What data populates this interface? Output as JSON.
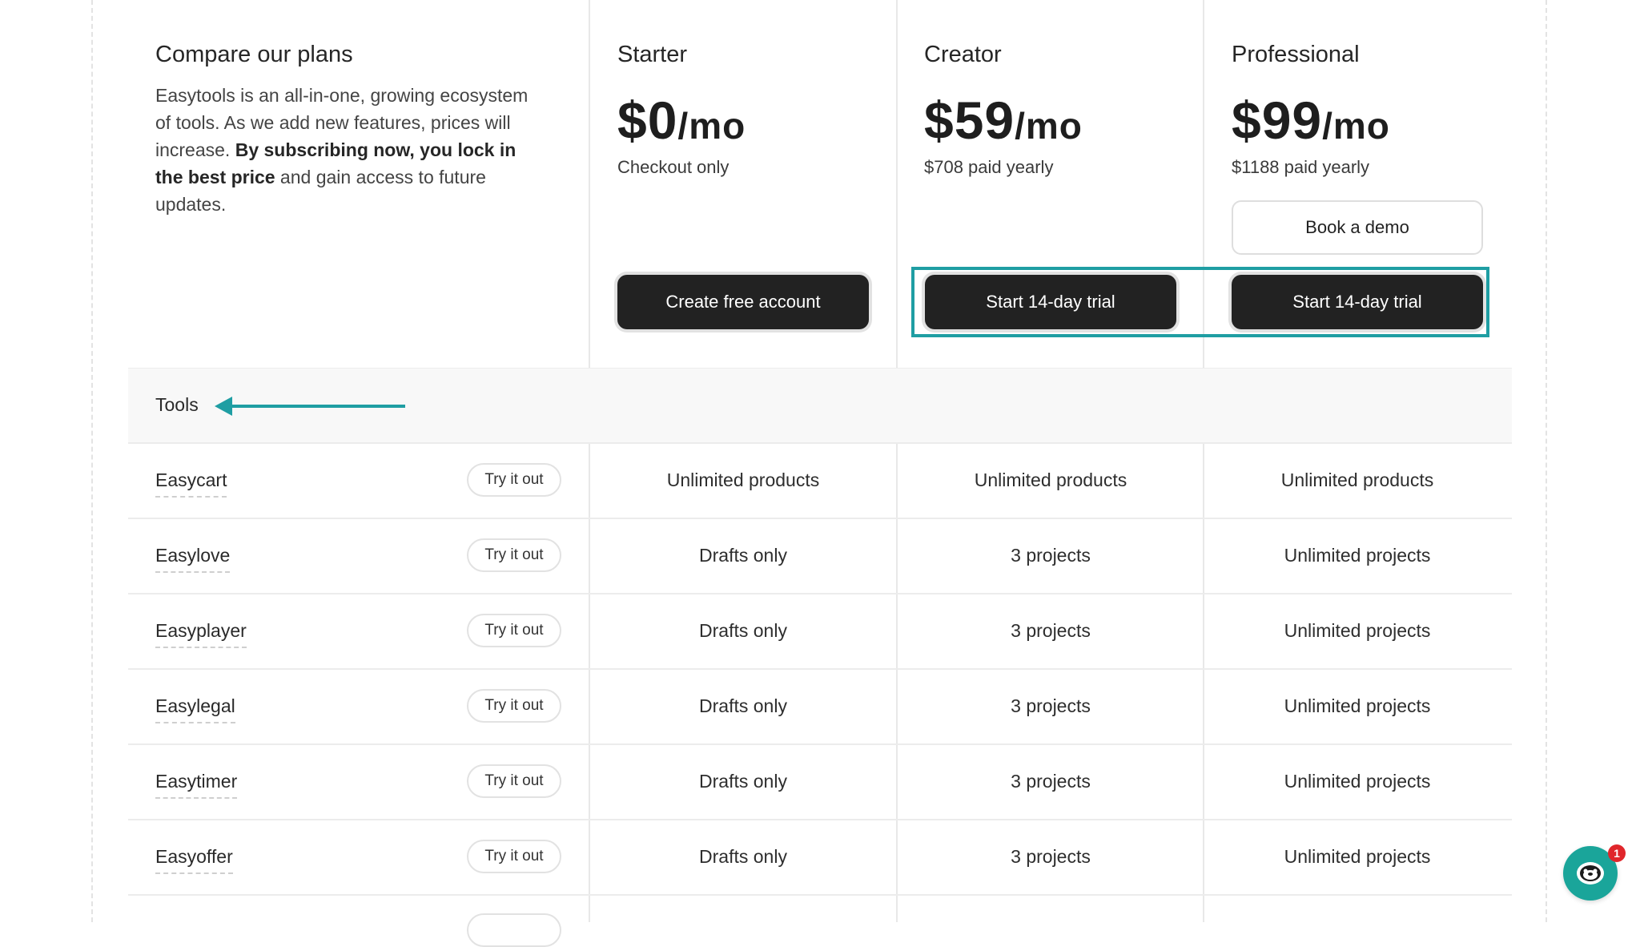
{
  "intro": {
    "title": "Compare our plans",
    "text_part1": "Easytools is an all-in-one, growing ecosystem of tools. As we add new features, prices will increase. ",
    "text_bold1": "By subscribing now, you lock in the best price",
    "text_part2": " and gain access to future updates."
  },
  "plans": [
    {
      "name": "Starter",
      "price": "$0",
      "per": "/mo",
      "sub": "Checkout only",
      "cta": "Create free account"
    },
    {
      "name": "Creator",
      "price": "$59",
      "per": "/mo",
      "sub": "$708 paid yearly",
      "cta": "Start 14-day trial"
    },
    {
      "name": "Professional",
      "price": "$99",
      "per": "/mo",
      "sub": "$1188 paid yearly",
      "cta": "Start 14-day trial",
      "secondary_cta": "Book a demo"
    }
  ],
  "section": {
    "label": "Tools"
  },
  "try_label": "Try it out",
  "tools": [
    {
      "name": "Easycart",
      "starter": "Unlimited products",
      "creator": "Unlimited products",
      "professional": "Unlimited products"
    },
    {
      "name": "Easylove",
      "starter": "Drafts only",
      "creator": "3 projects",
      "professional": "Unlimited projects"
    },
    {
      "name": "Easyplayer",
      "starter": "Drafts only",
      "creator": "3 projects",
      "professional": "Unlimited projects"
    },
    {
      "name": "Easylegal",
      "starter": "Drafts only",
      "creator": "3 projects",
      "professional": "Unlimited projects"
    },
    {
      "name": "Easytimer",
      "starter": "Drafts only",
      "creator": "3 projects",
      "professional": "Unlimited projects"
    },
    {
      "name": "Easyoffer",
      "starter": "Drafts only",
      "creator": "3 projects",
      "professional": "Unlimited projects"
    }
  ],
  "chat": {
    "badge": "1",
    "icon": "sloth-chat-icon"
  },
  "colors": {
    "accent": "#1f9ea3",
    "button_dark": "#222222",
    "chat": "#1aa59a",
    "badge": "#e0262b"
  }
}
